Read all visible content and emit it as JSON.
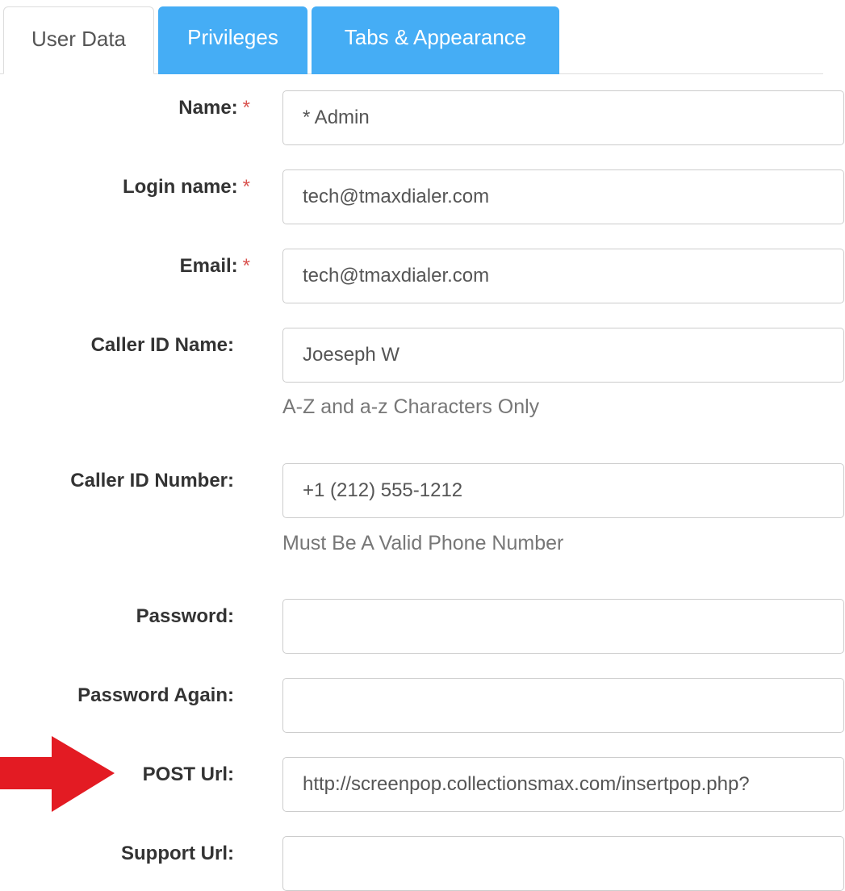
{
  "tabs": [
    {
      "label": "User Data",
      "active": true
    },
    {
      "label": "Privileges",
      "active": false
    },
    {
      "label": "Tabs & Appearance",
      "active": false
    }
  ],
  "colors": {
    "tab_inactive_bg": "#45adf5",
    "required_star": "#d9534f",
    "arrow": "#e31b23"
  },
  "form": {
    "required_marker": "*",
    "name": {
      "label": "Name:",
      "value": "* Admin"
    },
    "login_name": {
      "label": "Login name:",
      "value": "tech@tmaxdialer.com"
    },
    "email": {
      "label": "Email:",
      "value": "tech@tmaxdialer.com"
    },
    "caller_id_name": {
      "label": "Caller ID Name:",
      "value": "Joeseph W",
      "help": "A-Z and a-z Characters Only"
    },
    "caller_id_number": {
      "label": "Caller ID Number:",
      "value": "+1 (212) 555-1212",
      "help": "Must Be A Valid Phone Number"
    },
    "password": {
      "label": "Password:",
      "value": ""
    },
    "password_again": {
      "label": "Password Again:",
      "value": ""
    },
    "post_url": {
      "label": "POST Url:",
      "value": "http://screenpop.collectionsmax.com/insertpop.php?"
    },
    "support_url": {
      "label": "Support Url:",
      "value": ""
    }
  },
  "annotation": {
    "icon": "red-arrow-icon"
  }
}
